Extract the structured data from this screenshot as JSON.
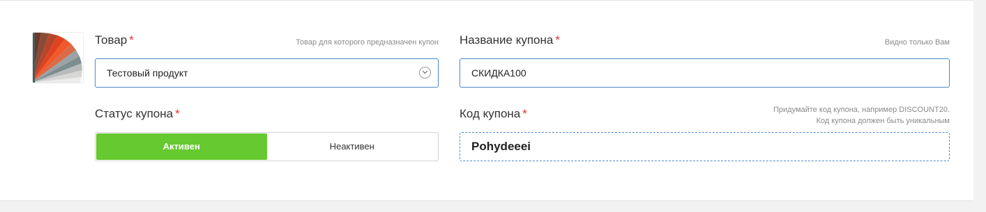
{
  "product": {
    "label": "Товар",
    "required_mark": "*",
    "hint": "Товар для которого предназначен купон",
    "selected_value": "Тестовый продукт"
  },
  "coupon_name": {
    "label": "Название купона",
    "required_mark": "*",
    "hint": "Видно только Вам",
    "value": "СКИДКА100"
  },
  "status": {
    "label": "Статус купона",
    "required_mark": "*",
    "options": [
      "Активен",
      "Неактивен"
    ],
    "selected": "Активен"
  },
  "coupon_code": {
    "label": "Код купона",
    "required_mark": "*",
    "hint_line1": "Придумайте код купона, например DISCOUNT20.",
    "hint_line2": "Код купона должен быть уникальным",
    "value": "Pohydeeei"
  },
  "colors": {
    "accent_border": "#4a88c7",
    "active_green": "#66c92f",
    "required_red": "#e3312f"
  }
}
